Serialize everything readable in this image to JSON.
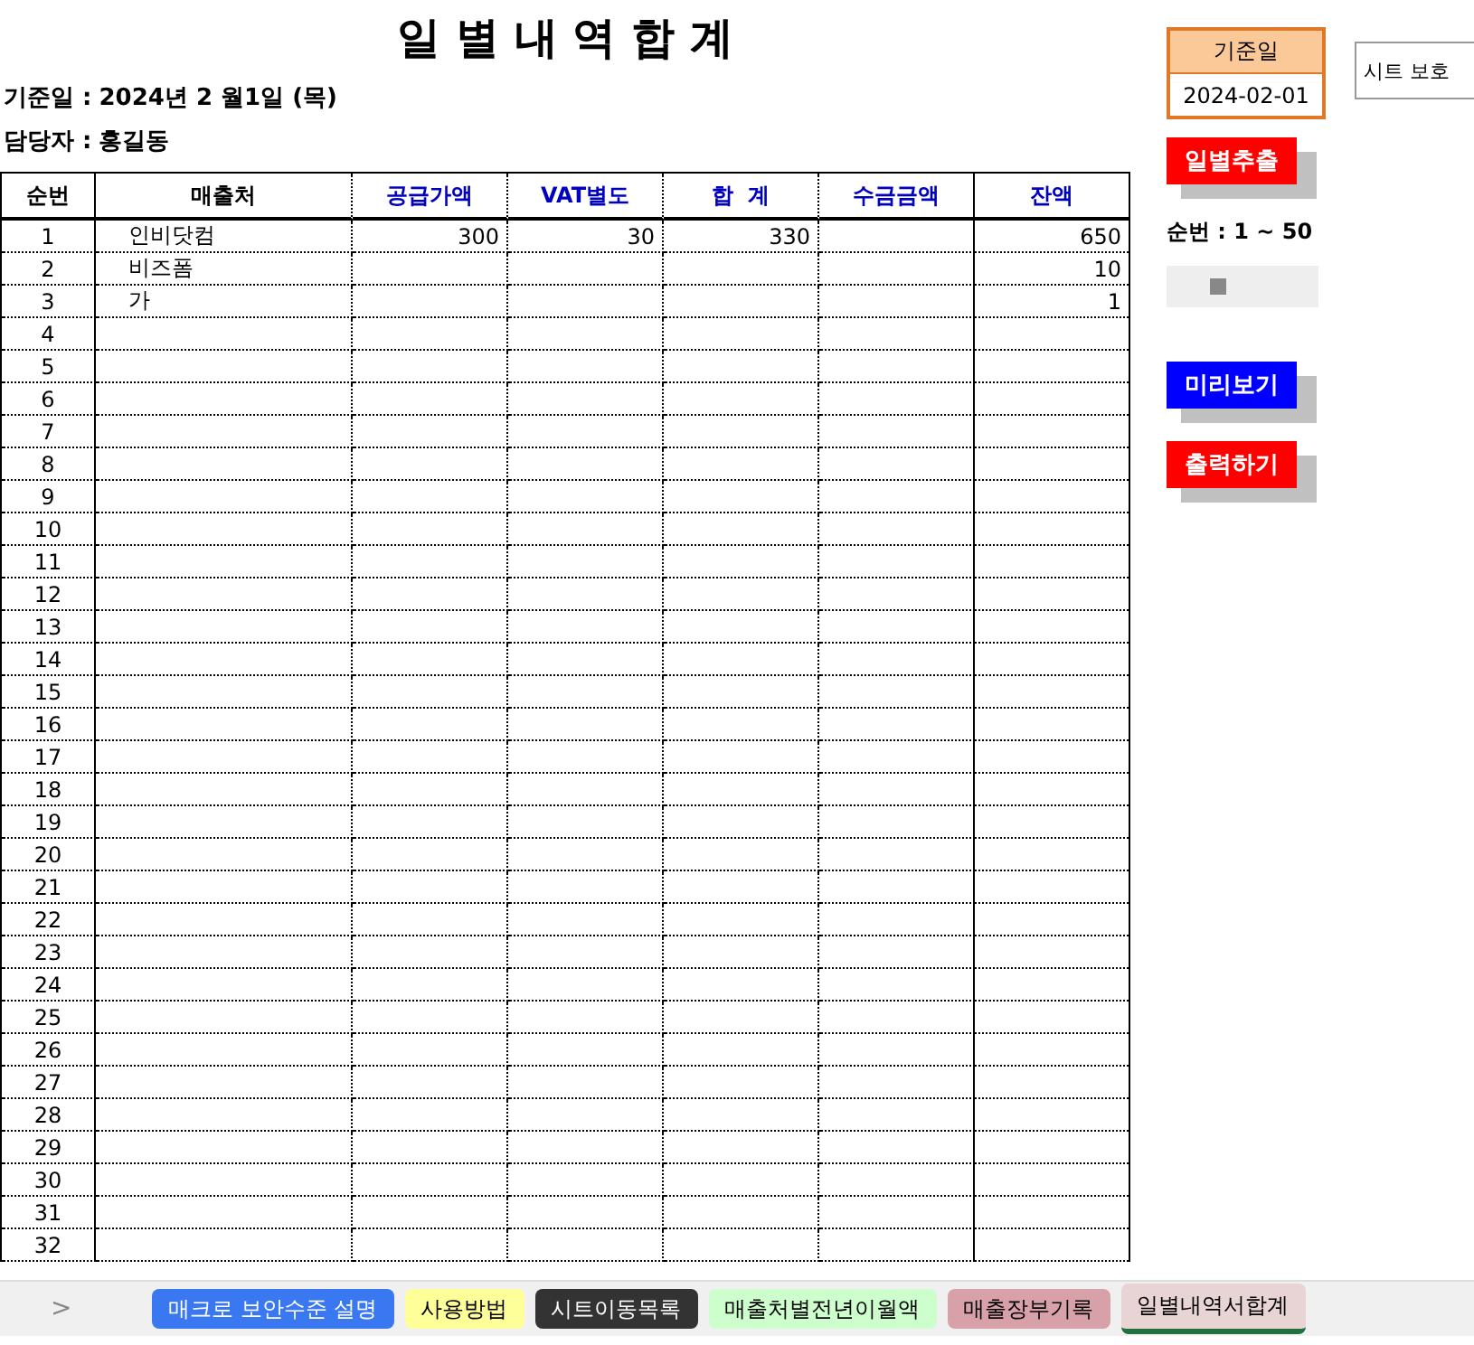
{
  "title": "일 별 내 역 합 계",
  "info": [
    {
      "label": "기준일 :",
      "value": "2024년 2 월1일 (목)"
    },
    {
      "label": "담당자 :",
      "value": "홍길동"
    }
  ],
  "table": {
    "columns": [
      {
        "label": "순번",
        "kind": "plain"
      },
      {
        "label": "매출처",
        "kind": "plain"
      },
      {
        "label": "공급가액",
        "kind": "blue"
      },
      {
        "label": "VAT별도",
        "kind": "blue"
      },
      {
        "label": "합  계",
        "kind": "blue"
      },
      {
        "label": "수금금액",
        "kind": "blue"
      },
      {
        "label": "잔액",
        "kind": "blue"
      }
    ],
    "rows": [
      {
        "no": "1",
        "customer": "인비닷컴",
        "supply": "300",
        "vat": "30",
        "total": "330",
        "balance": "650"
      },
      {
        "no": "2",
        "customer": "비즈폼",
        "balance": "10"
      },
      {
        "no": "3",
        "customer": "가",
        "balance": "1"
      },
      {
        "no": "4"
      },
      {
        "no": "5"
      },
      {
        "no": "6"
      },
      {
        "no": "7"
      },
      {
        "no": "8"
      },
      {
        "no": "9"
      },
      {
        "no": "10"
      },
      {
        "no": "11"
      },
      {
        "no": "12"
      },
      {
        "no": "13"
      },
      {
        "no": "14"
      },
      {
        "no": "15"
      },
      {
        "no": "16"
      },
      {
        "no": "17"
      },
      {
        "no": "18"
      },
      {
        "no": "19"
      },
      {
        "no": "20"
      },
      {
        "no": "21"
      },
      {
        "no": "22"
      },
      {
        "no": "23"
      },
      {
        "no": "24"
      },
      {
        "no": "25"
      },
      {
        "no": "26"
      },
      {
        "no": "27"
      },
      {
        "no": "28"
      },
      {
        "no": "29"
      },
      {
        "no": "30"
      },
      {
        "no": "31"
      },
      {
        "no": "32"
      }
    ]
  },
  "date_box": {
    "label": "기준일",
    "value": "2024-02-01"
  },
  "protect_button": "시트 보호",
  "buttons": [
    {
      "label": "일별추출",
      "color": "#ff0000"
    }
  ],
  "range_label": "순번 : 1 ~ 50",
  "buttons2": [
    {
      "label": "미리보기",
      "color": "#0000ff"
    },
    {
      "label": "출력하기",
      "color": "#ff0000"
    }
  ],
  "nav_arrow": ">",
  "sheet_tabs": [
    {
      "label": "매크로 보안수준 설명",
      "color": "#3a78f2",
      "selected": false
    },
    {
      "label": "사용방법",
      "color": "#ffff99",
      "selected": false
    },
    {
      "label": "시트이동목록",
      "color": "#333333",
      "selected": false
    },
    {
      "label": "매출처별전년이월액",
      "color": "#ccffcc",
      "selected": false
    },
    {
      "label": "매출장부기록",
      "color": "#d8a0a8",
      "selected": false
    },
    {
      "label": "일별내역서합계",
      "color": "#e8d4d4",
      "selected": true
    }
  ]
}
